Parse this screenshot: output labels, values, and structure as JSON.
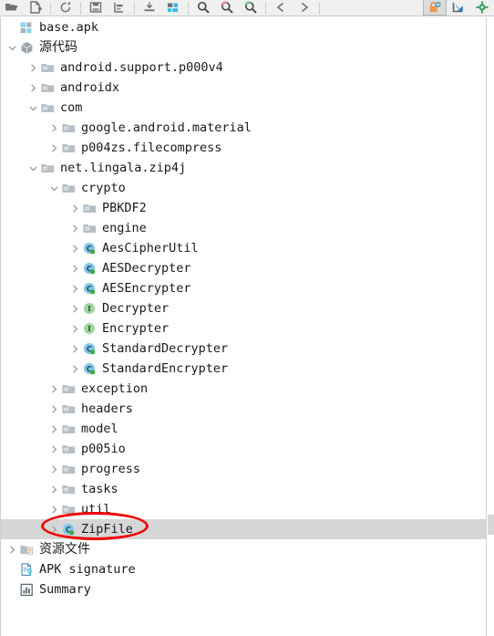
{
  "window": {
    "title": "base.apk",
    "accent_selection": "#d6d6d6",
    "annotation_color": "#ee0000"
  },
  "toolbar": {
    "buttons": [
      {
        "name": "open-folder-icon",
        "label": "Open",
        "icon": "folder-open",
        "pressed": false
      },
      {
        "name": "add-file-icon",
        "label": "Add file",
        "icon": "file-add",
        "pressed": false
      },
      {
        "name": "separator-1",
        "label": "",
        "icon": "separator",
        "pressed": false
      },
      {
        "name": "refresh-icon",
        "label": "Refresh",
        "icon": "refresh",
        "pressed": false
      },
      {
        "name": "separator-2",
        "label": "",
        "icon": "separator",
        "pressed": false
      },
      {
        "name": "save-icon",
        "label": "Save",
        "icon": "save",
        "pressed": false
      },
      {
        "name": "export-icon",
        "label": "Export",
        "icon": "export",
        "pressed": false
      },
      {
        "name": "separator-3",
        "label": "",
        "icon": "separator",
        "pressed": false
      },
      {
        "name": "collapse-icon",
        "label": "Collapse",
        "icon": "collapse",
        "pressed": false
      },
      {
        "name": "grid-view-icon",
        "label": "Grid view",
        "icon": "grid",
        "pressed": false
      },
      {
        "name": "separator-4",
        "label": "",
        "icon": "separator",
        "pressed": false
      },
      {
        "name": "search-icon",
        "label": "Search",
        "icon": "search",
        "pressed": false
      },
      {
        "name": "search-prev-icon",
        "label": "Find previous",
        "icon": "search-red",
        "pressed": false
      },
      {
        "name": "search-next-icon",
        "label": "Find next",
        "icon": "search-green",
        "pressed": false
      },
      {
        "name": "separator-5",
        "label": "",
        "icon": "separator",
        "pressed": false
      },
      {
        "name": "back-arrow-icon",
        "label": "Back",
        "icon": "arrow-back",
        "pressed": false
      },
      {
        "name": "forward-arrow-icon",
        "label": "Forward",
        "icon": "arrow-forward",
        "pressed": false
      },
      {
        "name": "separator-6",
        "label": "",
        "icon": "separator",
        "pressed": false
      },
      {
        "name": "lock-settings-icon",
        "label": "Deobfuscation settings",
        "icon": "lock-gear",
        "pressed": true
      },
      {
        "name": "measure-icon",
        "label": "Measure",
        "icon": "ruler",
        "pressed": false
      },
      {
        "name": "preferences-gear-icon",
        "label": "Preferences",
        "icon": "gear-green",
        "pressed": false
      }
    ]
  },
  "tree": {
    "selected_item": "ZipFile",
    "annotated_item": "ZipFile",
    "items": [
      {
        "label": "base.apk",
        "indent": 0,
        "icon": "apk",
        "twisty": "none",
        "selected": false
      },
      {
        "label": "源代码",
        "indent": 0,
        "icon": "package",
        "twisty": "expanded",
        "selected": false
      },
      {
        "label": "android.support.p000v4",
        "indent": 1,
        "icon": "folder",
        "twisty": "collapsed",
        "selected": false
      },
      {
        "label": "androidx",
        "indent": 1,
        "icon": "folder",
        "twisty": "collapsed",
        "selected": false
      },
      {
        "label": "com",
        "indent": 1,
        "icon": "folder",
        "twisty": "expanded",
        "selected": false
      },
      {
        "label": "google.android.material",
        "indent": 2,
        "icon": "folder",
        "twisty": "collapsed",
        "selected": false
      },
      {
        "label": "p004zs.filecompress",
        "indent": 2,
        "icon": "folder",
        "twisty": "collapsed",
        "selected": false
      },
      {
        "label": "net.lingala.zip4j",
        "indent": 1,
        "icon": "folder",
        "twisty": "expanded",
        "selected": false
      },
      {
        "label": "crypto",
        "indent": 2,
        "icon": "folder",
        "twisty": "expanded",
        "selected": false
      },
      {
        "label": "PBKDF2",
        "indent": 3,
        "icon": "folder",
        "twisty": "collapsed",
        "selected": false
      },
      {
        "label": "engine",
        "indent": 3,
        "icon": "folder",
        "twisty": "collapsed",
        "selected": false
      },
      {
        "label": "AesCipherUtil",
        "indent": 3,
        "icon": "class",
        "twisty": "collapsed",
        "selected": false
      },
      {
        "label": "AESDecrypter",
        "indent": 3,
        "icon": "class",
        "twisty": "collapsed",
        "selected": false
      },
      {
        "label": "AESEncrypter",
        "indent": 3,
        "icon": "class",
        "twisty": "collapsed",
        "selected": false
      },
      {
        "label": "Decrypter",
        "indent": 3,
        "icon": "interface",
        "twisty": "collapsed",
        "selected": false
      },
      {
        "label": "Encrypter",
        "indent": 3,
        "icon": "interface",
        "twisty": "collapsed",
        "selected": false
      },
      {
        "label": "StandardDecrypter",
        "indent": 3,
        "icon": "class",
        "twisty": "collapsed",
        "selected": false
      },
      {
        "label": "StandardEncrypter",
        "indent": 3,
        "icon": "class",
        "twisty": "collapsed",
        "selected": false
      },
      {
        "label": "exception",
        "indent": 2,
        "icon": "folder",
        "twisty": "collapsed",
        "selected": false
      },
      {
        "label": "headers",
        "indent": 2,
        "icon": "folder",
        "twisty": "collapsed",
        "selected": false
      },
      {
        "label": "model",
        "indent": 2,
        "icon": "folder",
        "twisty": "collapsed",
        "selected": false
      },
      {
        "label": "p005io",
        "indent": 2,
        "icon": "folder",
        "twisty": "collapsed",
        "selected": false
      },
      {
        "label": "progress",
        "indent": 2,
        "icon": "folder",
        "twisty": "collapsed",
        "selected": false
      },
      {
        "label": "tasks",
        "indent": 2,
        "icon": "folder",
        "twisty": "collapsed",
        "selected": false
      },
      {
        "label": "util",
        "indent": 2,
        "icon": "folder",
        "twisty": "collapsed",
        "selected": false
      },
      {
        "label": "ZipFile",
        "indent": 2,
        "icon": "class",
        "twisty": "collapsed",
        "selected": true
      },
      {
        "label": "资源文件",
        "indent": 0,
        "icon": "resource",
        "twisty": "collapsed",
        "selected": false
      },
      {
        "label": "APK signature",
        "indent": 0,
        "icon": "signature",
        "twisty": "none",
        "selected": false
      },
      {
        "label": "Summary",
        "indent": 0,
        "icon": "summary",
        "twisty": "none",
        "selected": false
      }
    ]
  }
}
